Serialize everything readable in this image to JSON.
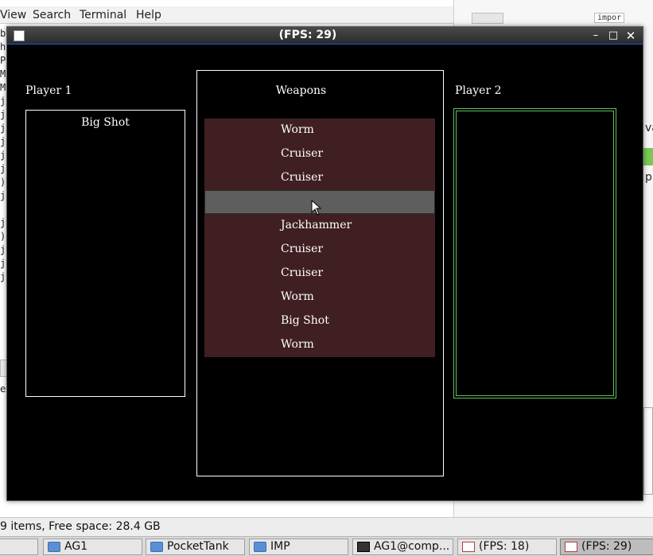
{
  "background_window": {
    "menu": [
      "View",
      "Search",
      "Terminal",
      "Help"
    ],
    "menu_underlines": [
      "V",
      "S",
      "T",
      "H"
    ],
    "side_chars": [
      "b",
      "h",
      "P",
      "M",
      "M",
      "j",
      "j",
      "j",
      "j",
      "j",
      "j",
      ")",
      "j",
      "",
      "j",
      ")",
      "j",
      "j",
      "j"
    ],
    "right_snippets": {
      "file_badge": "impor",
      "va": "va",
      "pr": "pr",
      "he": "e"
    },
    "status": "9 items, Free space: 28.4 GB"
  },
  "taskbar": {
    "items": [
      {
        "label": "",
        "icon": "blank"
      },
      {
        "label": "AG1",
        "icon": "folder-icon"
      },
      {
        "label": "PocketTank",
        "icon": "folder-icon"
      },
      {
        "label": "IMP",
        "icon": "folder-icon"
      },
      {
        "label": "AG1@comp...",
        "icon": "terminal-icon"
      },
      {
        "label": "(FPS: 18)",
        "icon": "java-icon"
      },
      {
        "label": "(FPS: 29)",
        "icon": "java-icon",
        "active": true
      }
    ]
  },
  "game_window": {
    "title": "(FPS: 29)",
    "controls": {
      "minimize": "–",
      "maximize": "□",
      "close": "✕"
    }
  },
  "game": {
    "player1": {
      "label": "Player 1",
      "weapon": "Big Shot"
    },
    "player2": {
      "label": "Player 2",
      "weapon": ""
    },
    "weapons": {
      "title": "Weapons",
      "items": [
        "Worm",
        "Cruiser",
        "Cruiser",
        "",
        "Jackhammer",
        "Cruiser",
        "Cruiser",
        "Worm",
        "Big Shot",
        "Worm"
      ],
      "selected_index": 3
    }
  },
  "colors": {
    "list_background": "#3f1f22",
    "selected_row": "#5e5e5e",
    "player2_border": "#5fbf5f"
  }
}
